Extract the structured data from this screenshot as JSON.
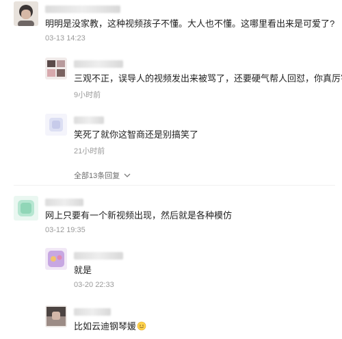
{
  "comments": [
    {
      "text": "明明是没家教，这种视频孩子不懂。大人也不懂。这哪里看出来是可爱了?",
      "date": "03-13 14:23",
      "replies": [
        {
          "text": "三观不正，误导人的视频发出来被骂了，还要硬气帮人回怼，你真厉害",
          "emoji_icon": "thumbs-up-icon",
          "date": "9小时前"
        },
        {
          "text": "笑死了就你这智商还是别搞笑了",
          "date": "21小时前"
        }
      ],
      "replies_link": "全部13条回复"
    },
    {
      "text": "网上只要有一个新视频出现，然后就是各种模仿",
      "date": "03-12 19:35",
      "replies": [
        {
          "text": "就是",
          "date": "03-20 22:33"
        },
        {
          "text": "比如云迪钢琴媛",
          "emoji_icon": "smile-emoji-icon"
        }
      ]
    }
  ],
  "colors": {
    "text": "#222222",
    "meta": "#9a9a9a",
    "link": "#6b6b6b",
    "background": "#ffffff"
  }
}
